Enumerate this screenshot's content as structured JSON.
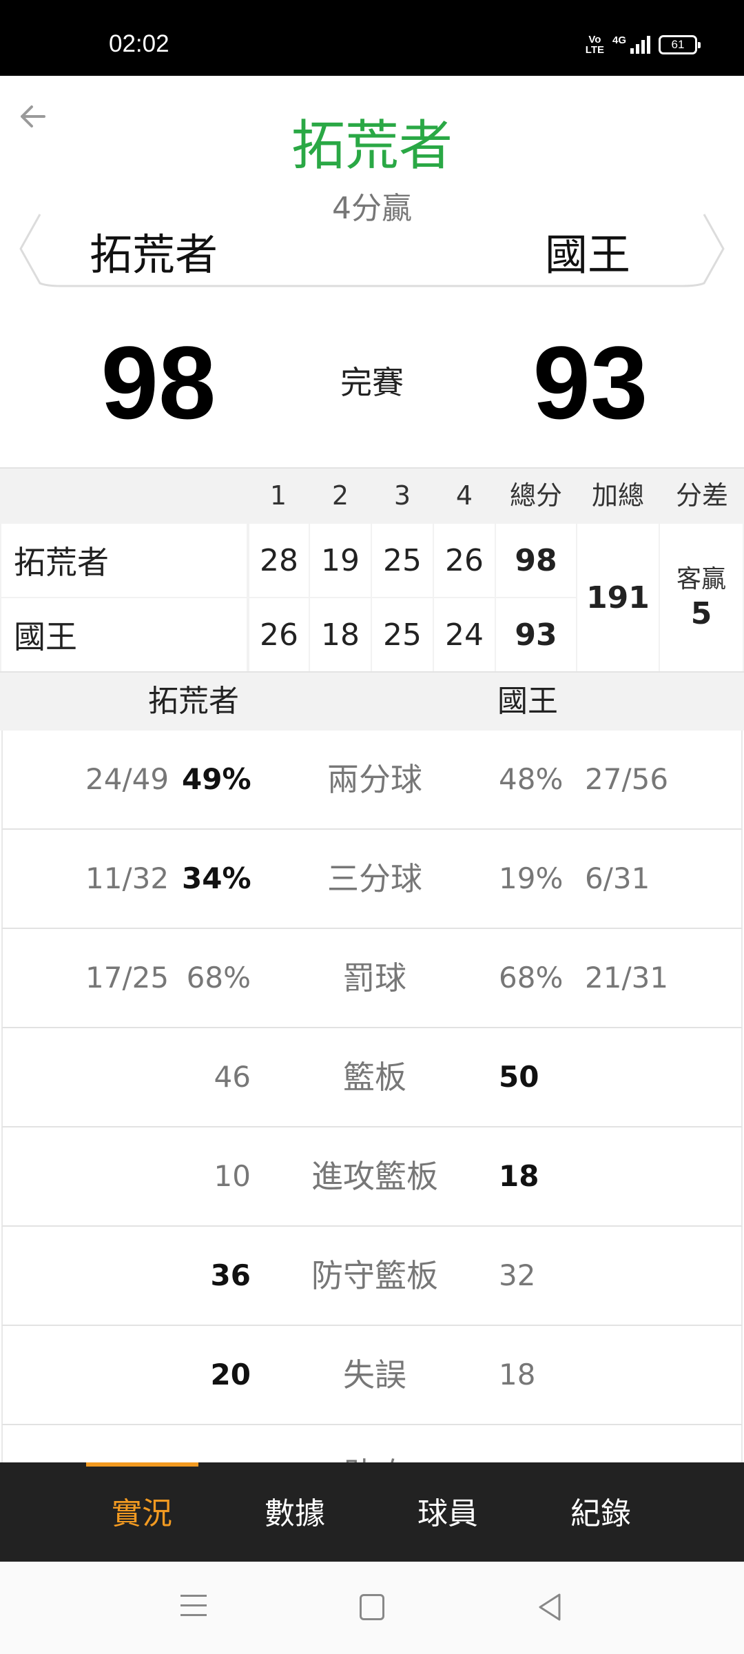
{
  "status_bar": {
    "time": "02:02",
    "volte_top": "Vo",
    "volte_bottom": "LTE",
    "network": "4G",
    "battery": "61"
  },
  "header": {
    "winner": "拓荒者",
    "margin_text": "4分贏"
  },
  "matchup": {
    "left_team": "拓荒者",
    "right_team": "國王",
    "left_score": "98",
    "right_score": "93",
    "status": "完賽"
  },
  "box_score": {
    "headers": [
      "1",
      "2",
      "3",
      "4",
      "總分",
      "加總",
      "分差"
    ],
    "rows": [
      {
        "team": "拓荒者",
        "q": [
          "28",
          "19",
          "25",
          "26"
        ],
        "total": "98"
      },
      {
        "team": "國王",
        "q": [
          "26",
          "18",
          "25",
          "24"
        ],
        "total": "93"
      }
    ],
    "sum": "191",
    "diff_label": "客贏",
    "diff_value": "5"
  },
  "stats": {
    "left_team": "拓荒者",
    "right_team": "國王",
    "rows": [
      {
        "label": "兩分球",
        "left_frac": "24/49",
        "left": "49%",
        "right": "48%",
        "right_frac": "27/56"
      },
      {
        "label": "三分球",
        "left_frac": "11/32",
        "left": "34%",
        "right": "19%",
        "right_frac": "6/31"
      },
      {
        "label": "罰球",
        "left_frac": "17/25",
        "left": "68%",
        "right": "68%",
        "right_frac": "21/31"
      },
      {
        "label": "籃板",
        "left_frac": "",
        "left": "46",
        "right": "50",
        "right_frac": ""
      },
      {
        "label": "進攻籃板",
        "left_frac": "",
        "left": "10",
        "right": "18",
        "right_frac": ""
      },
      {
        "label": "防守籃板",
        "left_frac": "",
        "left": "36",
        "right": "32",
        "right_frac": ""
      },
      {
        "label": "失誤",
        "left_frac": "",
        "left": "20",
        "right": "18",
        "right_frac": ""
      },
      {
        "label": "助攻",
        "left_frac": "",
        "left": "",
        "right": "",
        "right_frac": ""
      }
    ]
  },
  "tabs": [
    "實況",
    "數據",
    "球員",
    "紀錄"
  ],
  "colors": {
    "accent_green": "#2aa845",
    "accent_orange": "#f29a21",
    "tabbar_bg": "#222222"
  },
  "icons": {
    "back": "arrow-left-icon",
    "nav_menu": "menu-icon",
    "nav_home": "home-icon",
    "nav_back": "triangle-back-icon"
  }
}
